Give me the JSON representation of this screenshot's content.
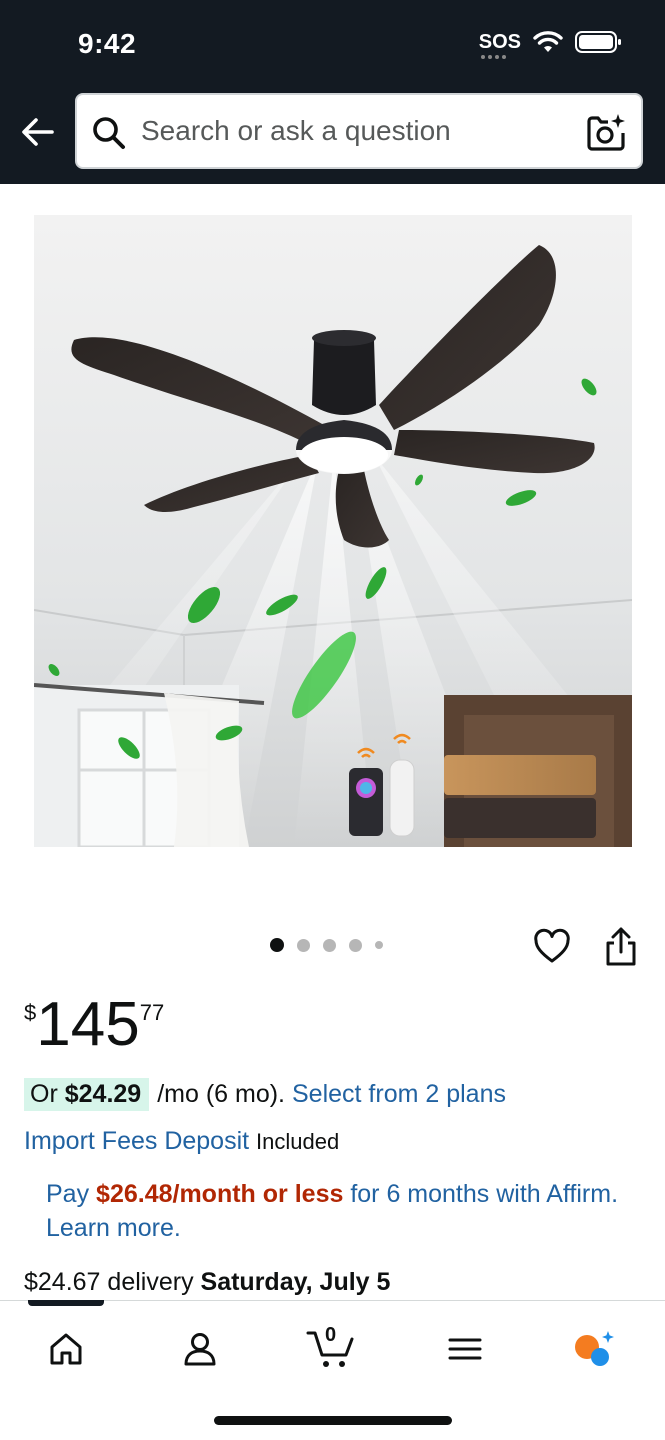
{
  "status_bar": {
    "time": "9:42",
    "sos": "SOS"
  },
  "search": {
    "placeholder": "Search or ask a question"
  },
  "product": {
    "image_count": 5,
    "active_image": 0,
    "price": {
      "symbol": "$",
      "whole": "145",
      "fraction": "77"
    },
    "installment": {
      "prefix": "Or",
      "amount": "$24.29",
      "term": "/mo (6 mo).",
      "link": "Select from 2 plans"
    },
    "import_fees": {
      "link": "Import Fees Deposit",
      "status": "Included"
    },
    "affirm": {
      "pay": "Pay",
      "amount": "$26.48/month or less",
      "tail": "for 6 months with Affirm. Learn more."
    },
    "delivery": {
      "price": "$24.67",
      "text": "delivery",
      "date": "Saturday, July 5"
    }
  },
  "tabbar": {
    "cart_count": "0",
    "active_tab": "home"
  },
  "colors": {
    "header": "#131a22",
    "link": "#2162a1",
    "deal": "#b12704",
    "highlight": "#d7f5ea"
  }
}
